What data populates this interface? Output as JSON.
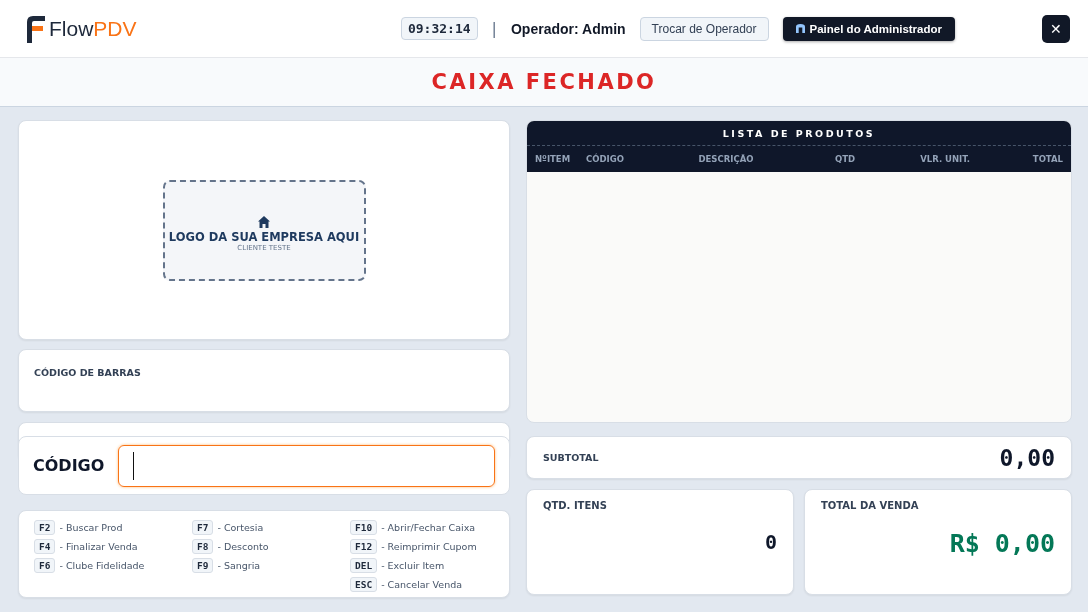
{
  "header": {
    "logo": {
      "brand_a": "Flow",
      "brand_b": "PDV"
    },
    "clock": "09:32:14",
    "separator": "|",
    "operator": "Operador: Admin",
    "switch_button": "Trocar de Operador",
    "admin_button": "Painel do Administrador",
    "close": "✕"
  },
  "status_title": "CAIXA FECHADO",
  "logo_placeholder": {
    "title": "LOGO DA SUA EMPRESA AQUI",
    "subtitle": "CLIENTE TESTE"
  },
  "barcode": {
    "label": "CÓDIGO DE BARRAS"
  },
  "code_entry": {
    "label": "CÓDIGO"
  },
  "shortcuts": [
    [
      {
        "key": "F2",
        "label": "- Buscar Prod"
      },
      {
        "key": "F4",
        "label": "- Finalizar Venda"
      },
      {
        "key": "F6",
        "label": "- Clube Fidelidade"
      }
    ],
    [
      {
        "key": "F7",
        "label": "- Cortesia"
      },
      {
        "key": "F8",
        "label": "- Desconto"
      },
      {
        "key": "F9",
        "label": "- Sangria"
      }
    ],
    [
      {
        "key": "F10",
        "label": "- Abrir/Fechar Caixa"
      },
      {
        "key": "F12",
        "label": "- Reimprimir Cupom"
      },
      {
        "key": "DEL",
        "label": "- Excluir Item"
      },
      {
        "key": "ESC",
        "label": "- Cancelar Venda"
      }
    ]
  ],
  "table": {
    "title": "LISTA DE PRODUTOS",
    "columns": [
      "NºITEM",
      "CÓDIGO",
      "DESCRIÇÃO",
      "QTD",
      "VLR. UNIT.",
      "TOTAL"
    ]
  },
  "subtotal": {
    "label": "SUBTOTAL",
    "value": "0,00"
  },
  "item_count": {
    "label": "QTD. ITENS",
    "value": "0"
  },
  "sale_total": {
    "label": "TOTAL DA VENDA",
    "value": "R$ 0,00"
  }
}
